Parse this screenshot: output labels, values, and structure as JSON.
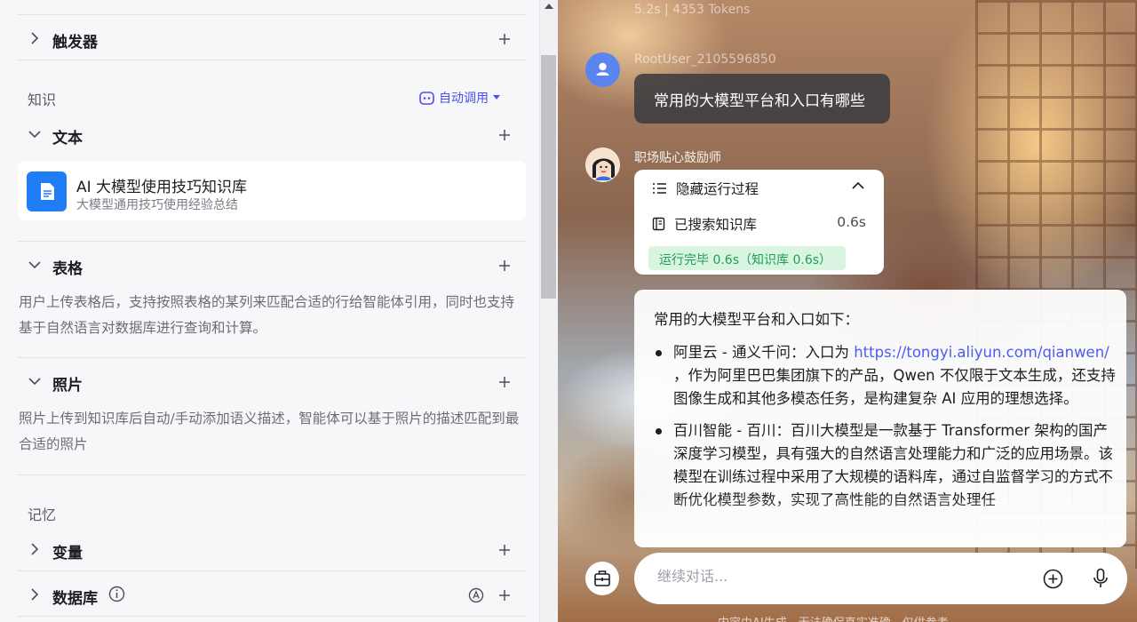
{
  "left": {
    "triggers": {
      "label": "触发器"
    },
    "knowledge": {
      "section_label": "知识",
      "auto_call_label": "自动调用",
      "text": {
        "label": "文本"
      },
      "kb_item": {
        "name": "AI 大模型使用技巧知识库",
        "desc": "大模型通用技巧使用经验总结"
      },
      "table": {
        "label": "表格",
        "desc": "用户上传表格后，支持按照表格的某列来匹配合适的行给智能体引用，同时也支持基于自然语言对数据库进行查询和计算。"
      },
      "photo": {
        "label": "照片",
        "desc": "照片上传到知识库后自动/手动添加语义描述，智能体可以基于照片的描述匹配到最合适的照片"
      }
    },
    "memory": {
      "section_label": "记忆",
      "variables": {
        "label": "变量"
      },
      "database": {
        "label": "数据库"
      }
    }
  },
  "chat": {
    "ghost_stats": "5.2s | 4353 Tokens",
    "user_name": "RootUser_2105596850",
    "user_message": "常用的大模型平台和入口有哪些",
    "bot_name": "职场贴心鼓励师",
    "run": {
      "hide_label": "隐藏运行过程",
      "searched_label": "已搜索知识库",
      "searched_time": "0.6s",
      "done_badge": "运行完毕 0.6s（知识库 0.6s）"
    },
    "answer": {
      "intro": "常用的大模型平台和入口如下：",
      "items": [
        {
          "before": "阿里云 - 通义千问：入口为 ",
          "link": "https://tongyi.aliyun.com/qianwen/",
          "after": " ，作为阿里巴巴集团旗下的产品，Qwen 不仅限于文本生成，还支持图像生成和其他多模态任务，是构建复杂 AI 应用的理想选择。"
        },
        {
          "before": "百川智能 - 百川：百川大模型是一款基于 Transformer 架构的国产深度学习模型，具有强大的自然语言处理能力和广泛的应用场景。该模型在训练过程中采用了大规模的语料库，通过自监督学习的方式不断优化模型参数，实现了高性能的自然语言处理任",
          "link": "",
          "after": ""
        }
      ]
    },
    "input_placeholder": "继续对话...",
    "footer_note": "内容由AI生成，无法确保真实准确，仅供参考"
  },
  "colors": {
    "accent": "#4b4ff0",
    "kb_icon": "#1f7ef5",
    "success_bg": "#d9f5e2",
    "success_text": "#1e9e55",
    "link": "#4b5cf0"
  }
}
